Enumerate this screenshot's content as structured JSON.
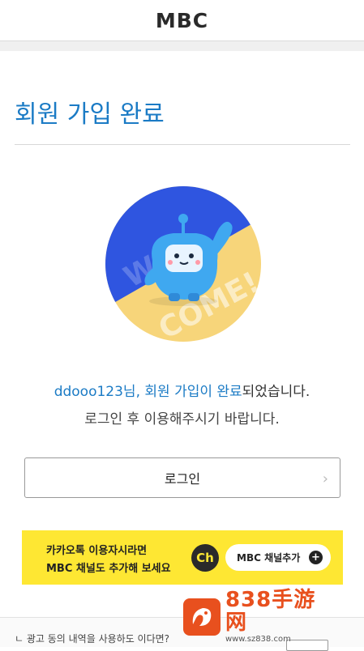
{
  "header": {
    "logo_text": "MBC"
  },
  "page": {
    "title": "회원 가입 완료"
  },
  "welcome_image": {
    "text_top": "WEL–",
    "text_bottom": "COME!",
    "colors": {
      "blue": "#2f55e0",
      "yellow": "#f7d57a",
      "mascot": "#3fa8f0"
    }
  },
  "message": {
    "highlight": "ddooo123님, 회원 가입이 완료",
    "rest": "되었습니다.",
    "line2": "로그인 후 이용해주시기 바랍니다."
  },
  "login_button": {
    "label": "로그인",
    "icon": "chevron-right-icon"
  },
  "kakao_banner": {
    "line1": "카카오톡 이용자시라면",
    "line2": "MBC 채널도 추가해 보세요",
    "ch_label": "Ch",
    "add_label": "MBC 채널추가",
    "plus": "+",
    "background": "#fee733"
  },
  "bottom": {
    "text": "ㄴ 광고 동의 내역을 사용하도 이다면?"
  },
  "watermark": {
    "main": "838手游网",
    "sub": "www.sz838.com"
  }
}
